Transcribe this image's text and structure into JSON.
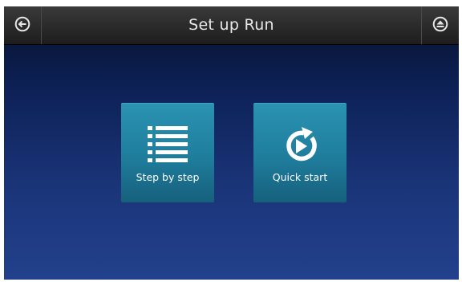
{
  "header": {
    "title": "Set up Run",
    "back_icon": "back-arrow-circle-icon",
    "eject_icon": "eject-circle-icon"
  },
  "options": [
    {
      "label": "Step by step",
      "icon": "list-icon"
    },
    {
      "label": "Quick start",
      "icon": "play-refresh-icon"
    }
  ],
  "colors": {
    "titlebar": "#2a2a2a",
    "background_top": "#06102a",
    "background_bottom": "#22418c",
    "tile": "#1f7d9c",
    "text": "#ffffff"
  }
}
